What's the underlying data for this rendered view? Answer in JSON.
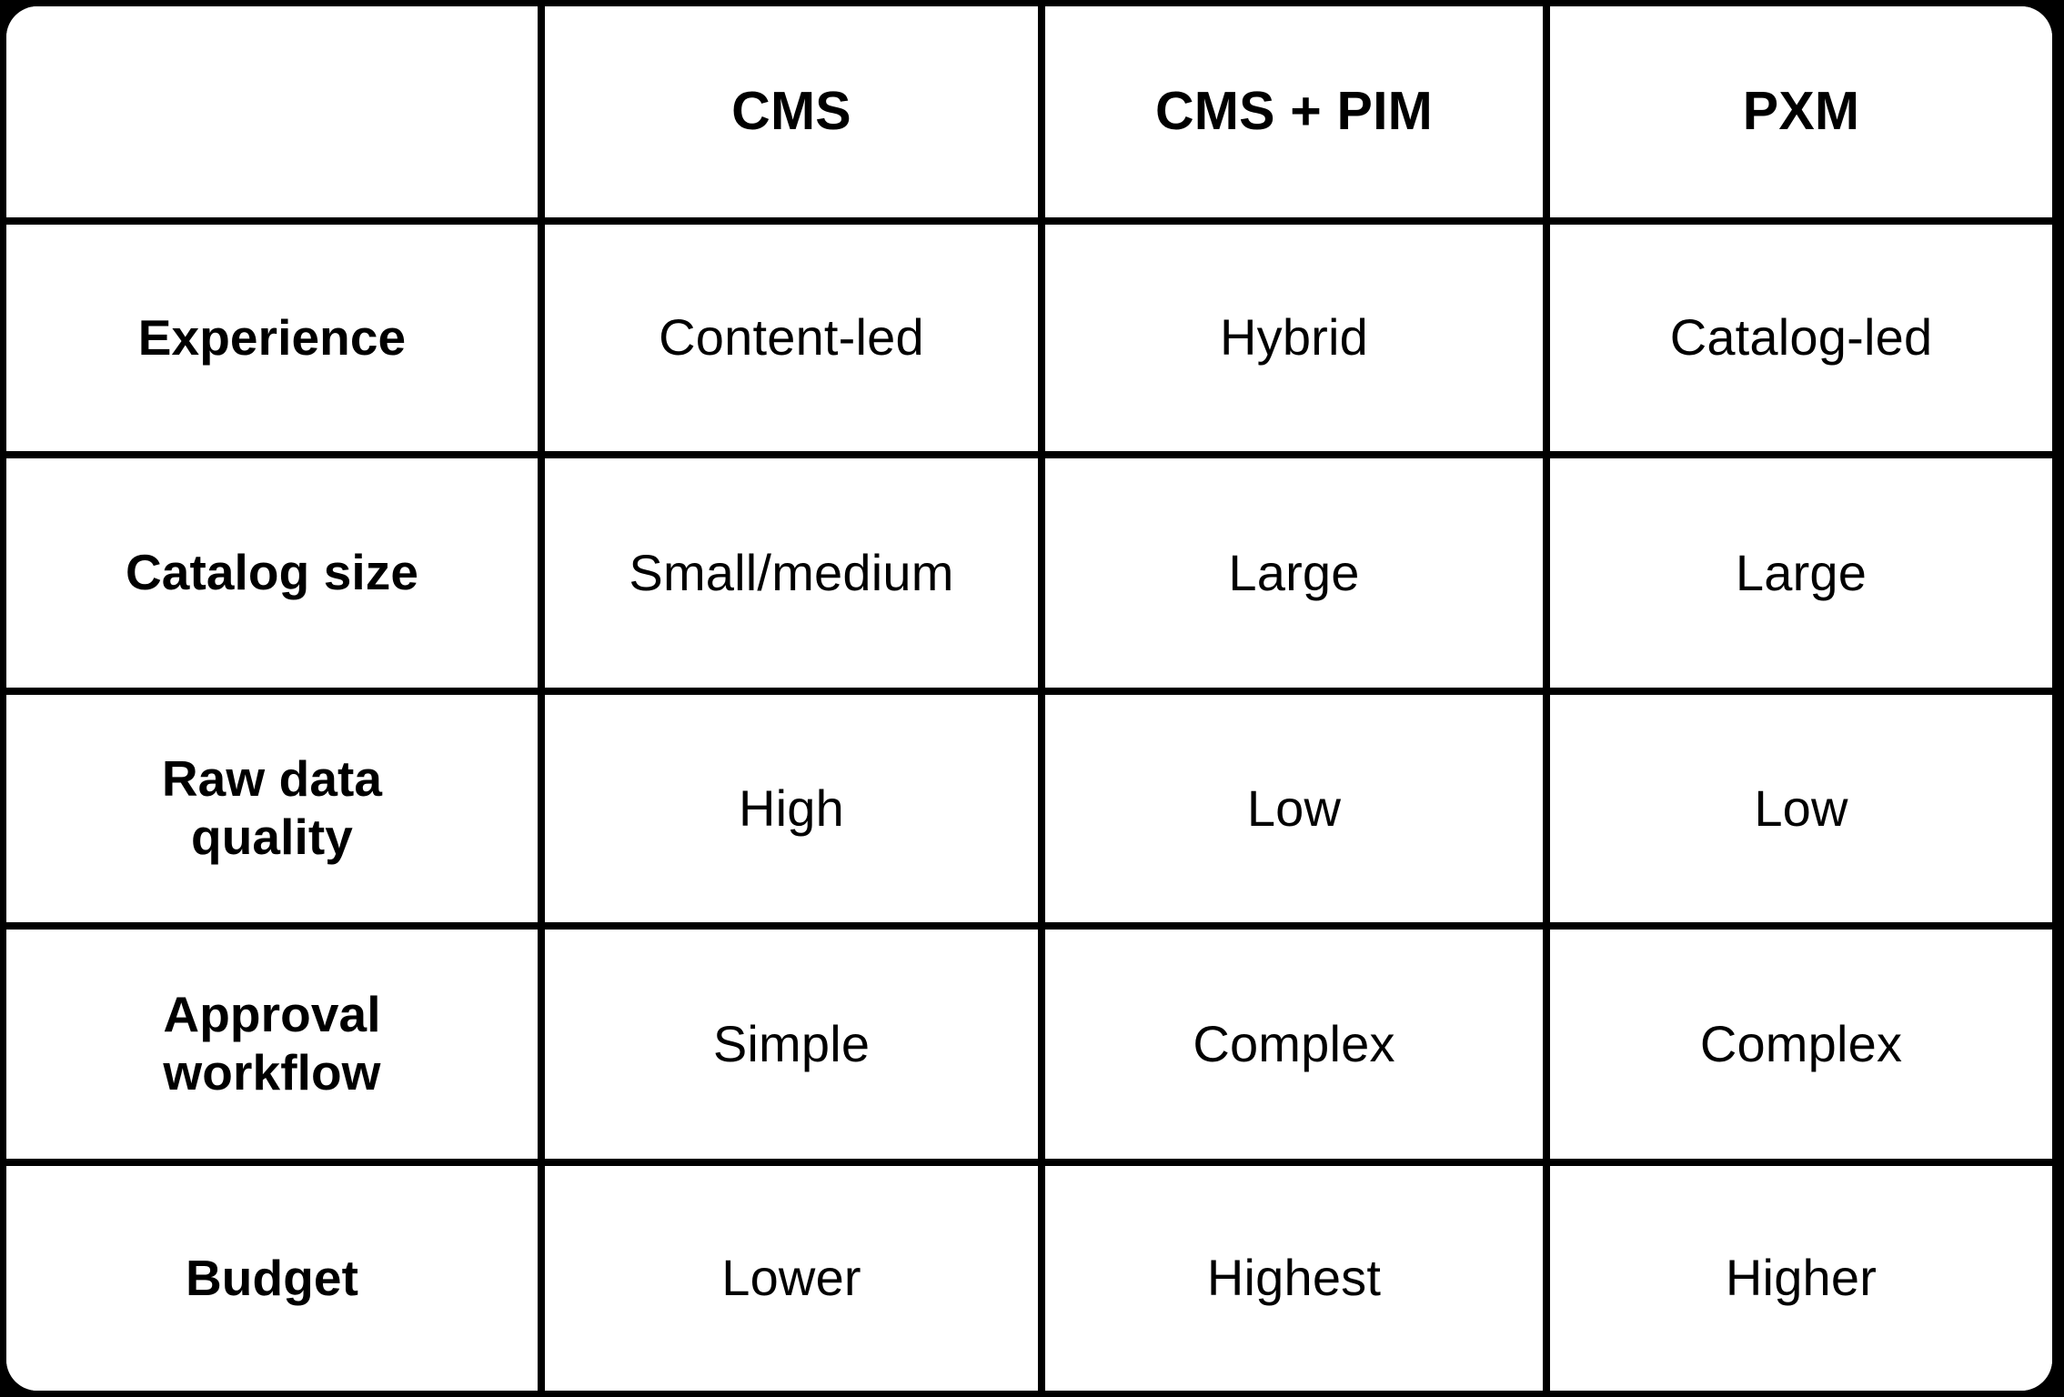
{
  "page": {
    "background_color": "#000000",
    "card_color": "#ffffff",
    "rule_color": "#000000"
  },
  "table": {
    "corner_label": "",
    "column_headers": [
      "CMS",
      "CMS + PIM",
      "PXM"
    ],
    "rows": [
      {
        "label": "Experience",
        "label_lines": [
          "Experience"
        ],
        "values": [
          "Content-led",
          "Hybrid",
          "Catalog-led"
        ]
      },
      {
        "label": "Catalog size",
        "label_lines": [
          "Catalog size"
        ],
        "values": [
          "Small/medium",
          "Large",
          "Large"
        ]
      },
      {
        "label": "Raw data quality",
        "label_lines": [
          "Raw data",
          "quality"
        ],
        "values": [
          "High",
          "Low",
          "Low"
        ]
      },
      {
        "label": "Approval workflow",
        "label_lines": [
          "Approval",
          "workflow"
        ],
        "values": [
          "Simple",
          "Complex",
          "Complex"
        ]
      },
      {
        "label": "Budget",
        "label_lines": [
          "Budget"
        ],
        "values": [
          "Lower",
          "Highest",
          "Higher"
        ]
      }
    ]
  },
  "chart_data": {
    "type": "table",
    "title": "",
    "categories": [
      "CMS",
      "CMS + PIM",
      "PXM"
    ],
    "row_labels": [
      "Experience",
      "Catalog size",
      "Raw data quality",
      "Approval workflow",
      "Budget"
    ],
    "cells": [
      [
        "Content-led",
        "Hybrid",
        "Catalog-led"
      ],
      [
        "Small/medium",
        "Large",
        "Large"
      ],
      [
        "High",
        "Low",
        "Low"
      ],
      [
        "Simple",
        "Complex",
        "Complex"
      ],
      [
        "Lower",
        "Highest",
        "Higher"
      ]
    ],
    "grid": true,
    "legend": "none"
  }
}
